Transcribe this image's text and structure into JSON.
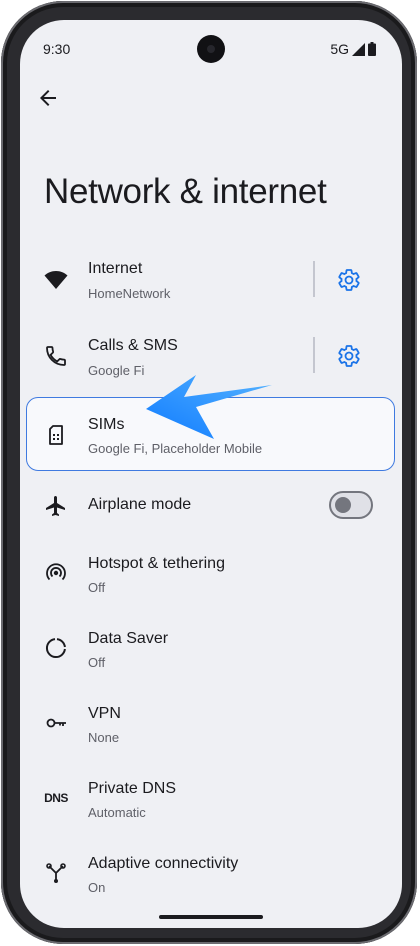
{
  "status_bar": {
    "time": "9:30",
    "network": "5G"
  },
  "page": {
    "title": "Network & internet"
  },
  "items": [
    {
      "label": "Internet",
      "sub": "HomeNetwork",
      "icon": "wifi-icon"
    },
    {
      "label": "Calls & SMS",
      "sub": "Google Fi",
      "icon": "phone-icon"
    },
    {
      "label": "SIMs",
      "sub": "Google Fi, Placeholder Mobile",
      "icon": "sim-card-icon"
    },
    {
      "label": "Airplane mode",
      "sub": "",
      "icon": "airplane-icon"
    },
    {
      "label": "Hotspot & tethering",
      "sub": "Off",
      "icon": "hotspot-icon"
    },
    {
      "label": "Data Saver",
      "sub": "Off",
      "icon": "data-saver-icon"
    },
    {
      "label": "VPN",
      "sub": "None",
      "icon": "vpn-key-icon"
    },
    {
      "label": "Private DNS",
      "sub": "Automatic",
      "icon": "dns-icon"
    },
    {
      "label": "Adaptive connectivity",
      "sub": "On",
      "icon": "adaptive-connectivity-icon"
    }
  ],
  "dns_icon_text": "DNS",
  "airplane_mode_enabled": false,
  "colors": {
    "accent": "#1a73e8",
    "highlight_border": "#3f7ae0",
    "arrow": "#1a8cff"
  }
}
